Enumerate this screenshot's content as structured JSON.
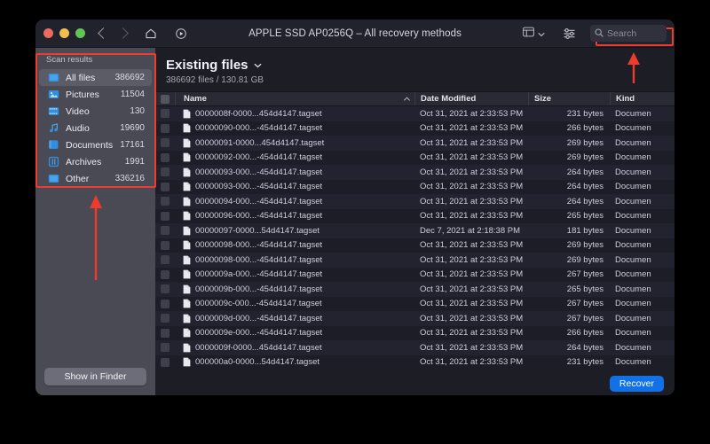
{
  "window": {
    "title": "APPLE SSD AP0256Q – All recovery methods",
    "traffic_lights": [
      "close",
      "minimize",
      "zoom"
    ],
    "nav": {
      "back": "back-chevron",
      "forward": "forward-chevron",
      "home": "home-icon",
      "rescan": "rescan-play-icon"
    },
    "view_switch_icon": "grid-view-icon",
    "view_switch_caret": "chevron-down-icon",
    "filter_icon": "filter-sliders-icon"
  },
  "search": {
    "icon": "search-icon",
    "placeholder": "Search",
    "value": ""
  },
  "sidebar": {
    "heading": "Scan results",
    "items": [
      {
        "label": "All files",
        "count": "386692",
        "icon": "all-files-icon",
        "active": true
      },
      {
        "label": "Pictures",
        "count": "11504",
        "icon": "pictures-icon",
        "active": false
      },
      {
        "label": "Video",
        "count": "130",
        "icon": "video-icon",
        "active": false
      },
      {
        "label": "Audio",
        "count": "19690",
        "icon": "audio-icon",
        "active": false
      },
      {
        "label": "Documents",
        "count": "17161",
        "icon": "documents-icon",
        "active": false
      },
      {
        "label": "Archives",
        "count": "1991",
        "icon": "archives-icon",
        "active": false
      },
      {
        "label": "Other",
        "count": "336216",
        "icon": "other-icon",
        "active": false
      }
    ],
    "show_in_finder": "Show in Finder"
  },
  "main": {
    "title": "Existing files",
    "title_caret": "chevron-down-icon",
    "summary": "386692 files / 130.81 GB",
    "columns": [
      "Name",
      "Date Modified",
      "Size",
      "Kind"
    ],
    "sort_column": "Name",
    "sort_direction": "ascending",
    "rows": [
      {
        "name": "0000008f-0000...454d4147.tagset",
        "date": "Oct 31, 2021 at 2:33:53 PM",
        "size": "231 bytes",
        "kind": "Documen"
      },
      {
        "name": "00000090-000...-454d4147.tagset",
        "date": "Oct 31, 2021 at 2:33:53 PM",
        "size": "266 bytes",
        "kind": "Documen"
      },
      {
        "name": "00000091-0000...454d4147.tagset",
        "date": "Oct 31, 2021 at 2:33:53 PM",
        "size": "269 bytes",
        "kind": "Documen"
      },
      {
        "name": "00000092-000...-454d4147.tagset",
        "date": "Oct 31, 2021 at 2:33:53 PM",
        "size": "269 bytes",
        "kind": "Documen"
      },
      {
        "name": "00000093-000...-454d4147.tagset",
        "date": "Oct 31, 2021 at 2:33:53 PM",
        "size": "264 bytes",
        "kind": "Documen"
      },
      {
        "name": "00000093-000...-454d4147.tagset",
        "date": "Oct 31, 2021 at 2:33:53 PM",
        "size": "264 bytes",
        "kind": "Documen"
      },
      {
        "name": "00000094-000...-454d4147.tagset",
        "date": "Oct 31, 2021 at 2:33:53 PM",
        "size": "264 bytes",
        "kind": "Documen"
      },
      {
        "name": "00000096-000...-454d4147.tagset",
        "date": "Oct 31, 2021 at 2:33:53 PM",
        "size": "265 bytes",
        "kind": "Documen"
      },
      {
        "name": "00000097-0000...54d4147.tagset",
        "date": "Dec 7, 2021 at 2:18:38 PM",
        "size": "181 bytes",
        "kind": "Documen"
      },
      {
        "name": "00000098-000...-454d4147.tagset",
        "date": "Oct 31, 2021 at 2:33:53 PM",
        "size": "269 bytes",
        "kind": "Documen"
      },
      {
        "name": "00000098-000...-454d4147.tagset",
        "date": "Oct 31, 2021 at 2:33:53 PM",
        "size": "269 bytes",
        "kind": "Documen"
      },
      {
        "name": "0000009a-000...-454d4147.tagset",
        "date": "Oct 31, 2021 at 2:33:53 PM",
        "size": "267 bytes",
        "kind": "Documen"
      },
      {
        "name": "0000009b-000...-454d4147.tagset",
        "date": "Oct 31, 2021 at 2:33:53 PM",
        "size": "265 bytes",
        "kind": "Documen"
      },
      {
        "name": "0000009c-000...-454d4147.tagset",
        "date": "Oct 31, 2021 at 2:33:53 PM",
        "size": "267 bytes",
        "kind": "Documen"
      },
      {
        "name": "0000009d-000...-454d4147.tagset",
        "date": "Oct 31, 2021 at 2:33:53 PM",
        "size": "267 bytes",
        "kind": "Documen"
      },
      {
        "name": "0000009e-000...-454d4147.tagset",
        "date": "Oct 31, 2021 at 2:33:53 PM",
        "size": "266 bytes",
        "kind": "Documen"
      },
      {
        "name": "0000009f-0000...454d4147.tagset",
        "date": "Oct 31, 2021 at 2:33:53 PM",
        "size": "264 bytes",
        "kind": "Documen"
      },
      {
        "name": "000000a0-0000...54d4147.tagset",
        "date": "Oct 31, 2021 at 2:33:53 PM",
        "size": "231 bytes",
        "kind": "Documen"
      }
    ]
  },
  "footer": {
    "recover_label": "Recover"
  },
  "annotations": {
    "color": "#ef3b2d",
    "boxes": [
      "sidebar-scan-results",
      "search-field"
    ],
    "arrows": [
      "arrow-up-to-sidebar",
      "arrow-up-to-search"
    ]
  },
  "colors": {
    "accent_button": "#1272e5",
    "annotation": "#ef3b2d",
    "sidebar_bg": "#4a4a55",
    "window_bg": "#1d1d26",
    "icon_blue": "#2f8fe0"
  }
}
